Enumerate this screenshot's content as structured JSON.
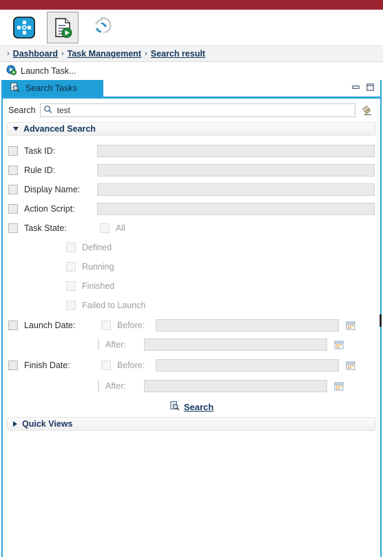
{
  "window": {
    "accent_red": "#9c2431",
    "accent_blue": "#1f9fd8"
  },
  "toolbar": {
    "buttons": [
      {
        "name": "dashboard-navigator-button",
        "icon": "navigator-icon",
        "label": ""
      },
      {
        "name": "launch-task-button",
        "icon": "document-play-icon",
        "label": ""
      },
      {
        "name": "refresh-gear-button",
        "icon": "gear-refresh-icon",
        "label": ""
      }
    ]
  },
  "breadcrumb": {
    "separator": "›",
    "items": [
      {
        "label": "Dashboard"
      },
      {
        "label": "Task Management"
      },
      {
        "label": "Search result"
      }
    ]
  },
  "action_bar": {
    "launch_task_label": "Launch Task...",
    "launch_task_icon": "launch-task-icon"
  },
  "panel": {
    "tab": {
      "label": "Search Tasks",
      "icon": "search-tasks-icon"
    },
    "window_controls": [
      {
        "name": "minimize-button",
        "icon": "minimize-icon"
      },
      {
        "name": "maximize-button",
        "icon": "maximize-icon"
      }
    ]
  },
  "search": {
    "label": "Search",
    "icon": "magnifier-icon",
    "value": "test",
    "placeholder": "",
    "clear_icon": "eraser-icon"
  },
  "advanced_search": {
    "title": "Advanced Search",
    "expanded": true,
    "fields": [
      {
        "name": "task-id",
        "label": "Task ID:",
        "value": "",
        "checked": false
      },
      {
        "name": "rule-id",
        "label": "Rule ID:",
        "value": "",
        "checked": false
      },
      {
        "name": "display-name",
        "label": "Display Name:",
        "value": "",
        "checked": false
      },
      {
        "name": "action-script",
        "label": "Action Script:",
        "value": "",
        "checked": false
      }
    ],
    "task_state": {
      "label": "Task State:",
      "checked": false,
      "options": [
        {
          "name": "all",
          "label": "All",
          "checked": false
        },
        {
          "name": "defined",
          "label": "Defined",
          "checked": false
        },
        {
          "name": "running",
          "label": "Running",
          "checked": false
        },
        {
          "name": "finished",
          "label": "Finished",
          "checked": false
        },
        {
          "name": "failed-to-launch",
          "label": "Failed to Launch",
          "checked": false
        }
      ]
    },
    "launch_date": {
      "label": "Launch Date:",
      "checked": false,
      "rows": [
        {
          "name": "launch-before",
          "label": "Before:",
          "value": "",
          "checked": false,
          "calendar_icon": "calendar-icon"
        },
        {
          "name": "launch-after",
          "label": "After:",
          "value": "",
          "checked": false,
          "calendar_icon": "calendar-icon"
        }
      ]
    },
    "finish_date": {
      "label": "Finish Date:",
      "checked": false,
      "rows": [
        {
          "name": "finish-before",
          "label": "Before:",
          "value": "",
          "checked": false,
          "calendar_icon": "calendar-icon"
        },
        {
          "name": "finish-after",
          "label": "After:",
          "value": "",
          "checked": false,
          "calendar_icon": "calendar-icon"
        }
      ]
    },
    "submit": {
      "label": "Search",
      "icon": "search-action-icon"
    }
  },
  "quick_views": {
    "title": "Quick Views",
    "expanded": false
  }
}
